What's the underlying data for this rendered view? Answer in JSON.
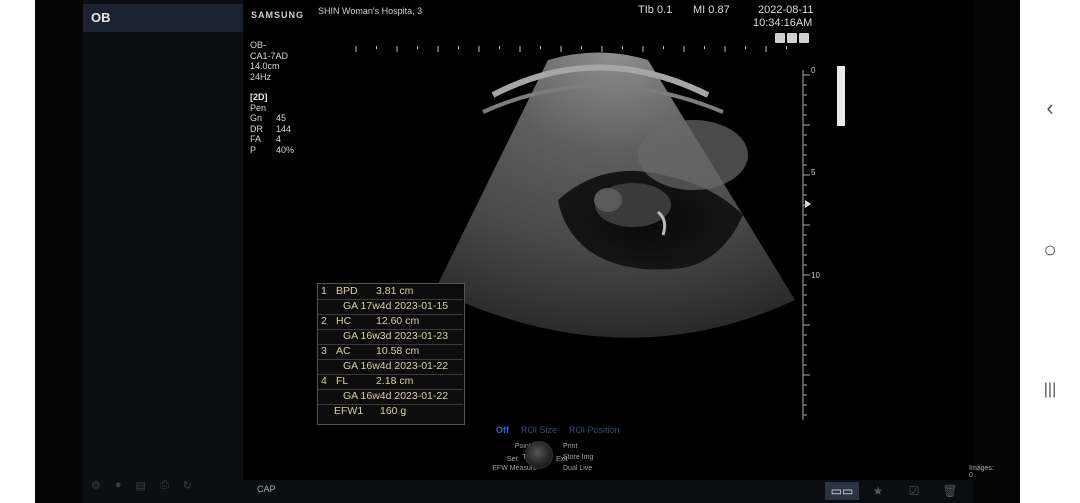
{
  "android_nav": {
    "back": "‹",
    "home": "○",
    "recents": "|||"
  },
  "sidebar": {
    "mode": "OB"
  },
  "header": {
    "brand": "SAMSUNG",
    "hospital": "SHIN Woman's Hospita, 3",
    "tib": "TIb   0.1",
    "mi": "MI    0.87",
    "date": "2022-08-11",
    "time": "10:34:16AM"
  },
  "params_top": [
    "OB-",
    "CA1-7AD",
    "14.0cm",
    "24Hz"
  ],
  "params_mode": {
    "head": "[2D]",
    "sub": "Pen",
    "rows": [
      {
        "k": "Gn",
        "v": "45"
      },
      {
        "k": "DR",
        "v": "144"
      },
      {
        "k": "FA",
        "v": "4"
      },
      {
        "k": "P",
        "v": "40%"
      }
    ]
  },
  "depth_labels": [
    "0",
    "5",
    "10"
  ],
  "measurements": {
    "items": [
      {
        "num": "1",
        "name": "BPD",
        "value": "3.81 cm",
        "ga": "GA 17w4d  2023-01-15"
      },
      {
        "num": "2",
        "name": "HC",
        "value": "12.60 cm",
        "ga": "GA 16w3d  2023-01-23"
      },
      {
        "num": "3",
        "name": "AC",
        "value": "10.58 cm",
        "ga": "GA 16w4d  2023-01-22"
      },
      {
        "num": "4",
        "name": "FL",
        "value": "2.18 cm",
        "ga": "GA 16w4d  2023-01-22"
      }
    ],
    "efw_label": "EFW1",
    "efw_value": "160 g"
  },
  "roi": {
    "off": "Off",
    "size": "ROI Size",
    "position": "ROI Position"
  },
  "controls": {
    "left": [
      "Pointer",
      "TGC",
      "EFW Measure"
    ],
    "right": [
      "Print",
      "Store Img",
      "Dual Live"
    ],
    "set": "Set",
    "exit": "Exit"
  },
  "images_label": "Images: 0",
  "cap_label": "CAP",
  "colors": {
    "panel_bg": "#000000",
    "accent": "#2f5bd8",
    "meas_text": "#d8d0a8"
  }
}
